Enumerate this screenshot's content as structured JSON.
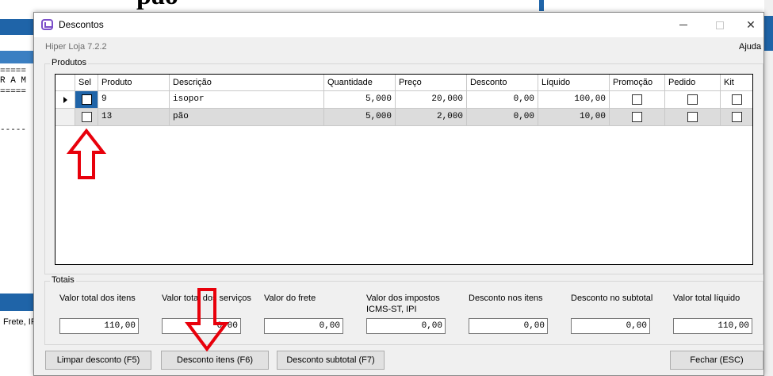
{
  "background": {
    "big_text": "pão",
    "mono_lines": [
      "=====",
      "R A M",
      "=====",
      "",
      "",
      "",
      "-----"
    ],
    "frete_text": "Frete, IP"
  },
  "window": {
    "title": "Descontos",
    "icon": "hiper-app-icon",
    "close_glyph": "✕"
  },
  "header": {
    "version": "Hiper Loja 7.2.2",
    "help": "Ajuda"
  },
  "produtos": {
    "group_label": "Produtos",
    "columns": [
      "Sel",
      "Produto",
      "Descrição",
      "Quantidade",
      "Preço",
      "Desconto",
      "Líquido",
      "Promoção",
      "Pedido",
      "Kit"
    ],
    "rows": [
      {
        "produto": "9",
        "descricao": "isopor",
        "quantidade": "5,000",
        "preco": "20,000",
        "desconto": "0,00",
        "liquido": "100,00",
        "selected": false,
        "promocao": false,
        "pedido": false,
        "kit": false
      },
      {
        "produto": "13",
        "descricao": "pão",
        "quantidade": "5,000",
        "preco": "2,000",
        "desconto": "0,00",
        "liquido": "10,00",
        "selected": false,
        "promocao": false,
        "pedido": false,
        "kit": false
      }
    ]
  },
  "totais": {
    "group_label": "Totais",
    "fields": [
      {
        "label": "Valor total dos itens",
        "value": "110,00"
      },
      {
        "label": "Valor total dos serviços",
        "value": "0,00"
      },
      {
        "label": "Valor do frete",
        "value": "0,00"
      },
      {
        "label": "Valor dos impostos ICMS-ST, IPI",
        "value": "0,00"
      },
      {
        "label": "Desconto nos itens",
        "value": "0,00"
      },
      {
        "label": "Desconto no subtotal",
        "value": "0,00"
      },
      {
        "label": "Valor total líquido",
        "value": "110,00"
      }
    ]
  },
  "buttons": {
    "limpar": "Limpar desconto (F5)",
    "desconto_itens": "Desconto itens (F6)",
    "desconto_subtotal": "Desconto subtotal (F7)",
    "fechar": "Fechar (ESC)"
  },
  "colors": {
    "annotation": "#e8000b",
    "selection": "#1f64a8",
    "row_alt": "#dcdcdc"
  }
}
